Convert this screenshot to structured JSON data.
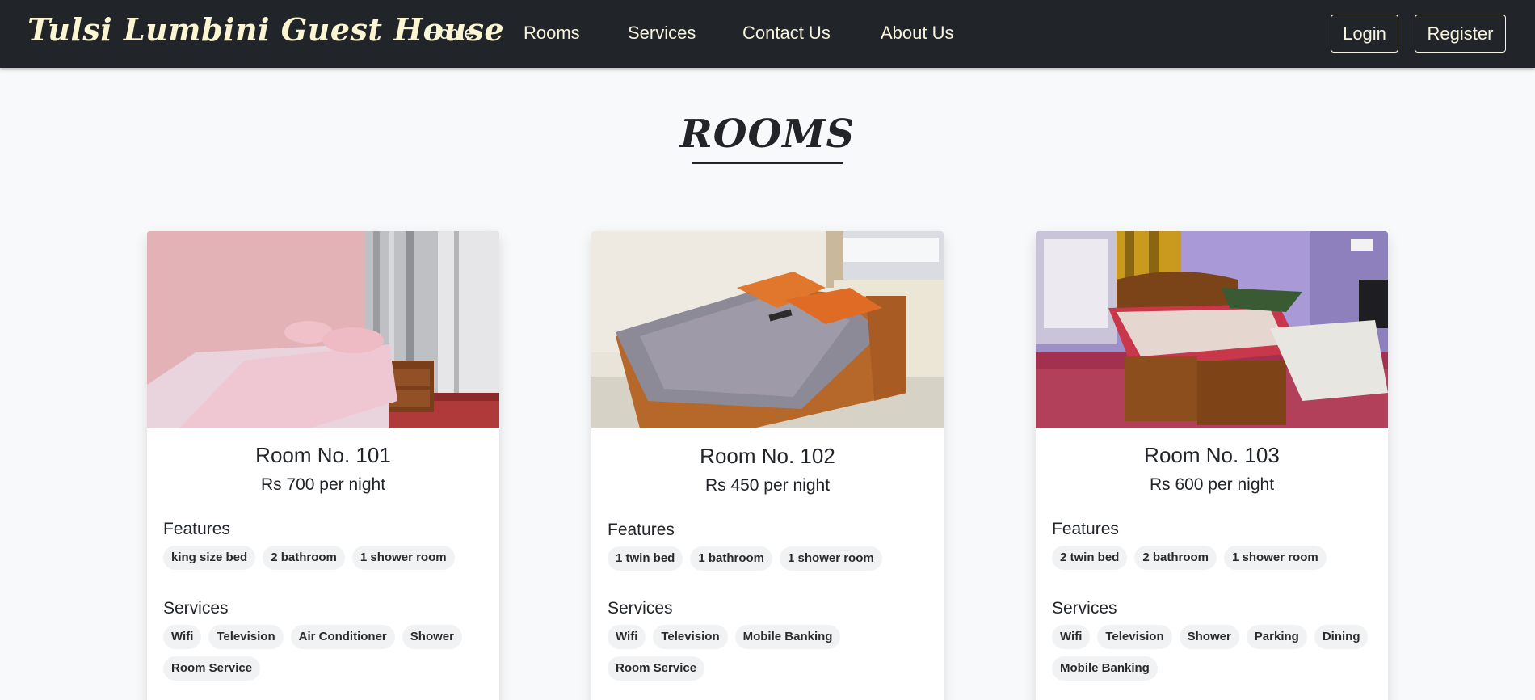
{
  "brand": "Tulsi Lumbini Guest House",
  "nav": {
    "home": "Home",
    "rooms": "Rooms",
    "services": "Services",
    "contact": "Contact Us",
    "about": "About Us"
  },
  "auth": {
    "login": "Login",
    "register": "Register"
  },
  "page_title": "ROOMS",
  "labels": {
    "features": "Features",
    "services": "Services"
  },
  "rooms": [
    {
      "name": "Room No. 101",
      "price": "Rs 700 per night",
      "features": [
        "king size bed",
        "2 bathroom",
        "1 shower room"
      ],
      "services": [
        "Wifi",
        "Television",
        "Air Conditioner",
        "Shower",
        "Room Service"
      ]
    },
    {
      "name": "Room No. 102",
      "price": "Rs 450 per night",
      "features": [
        "1 twin bed",
        "1 bathroom",
        "1 shower room"
      ],
      "services": [
        "Wifi",
        "Television",
        "Mobile Banking",
        "Room Service"
      ]
    },
    {
      "name": "Room No. 103",
      "price": "Rs 600 per night",
      "features": [
        "2 twin bed",
        "2 bathroom",
        "1 shower room"
      ],
      "services": [
        "Wifi",
        "Television",
        "Shower",
        "Parking",
        "Dining",
        "Mobile Banking"
      ]
    }
  ],
  "colors": {
    "navbar_bg": "#212529",
    "nav_text": "#f7f3dc",
    "page_bg": "#f8f9fa",
    "badge_bg": "#f1f2f3"
  }
}
